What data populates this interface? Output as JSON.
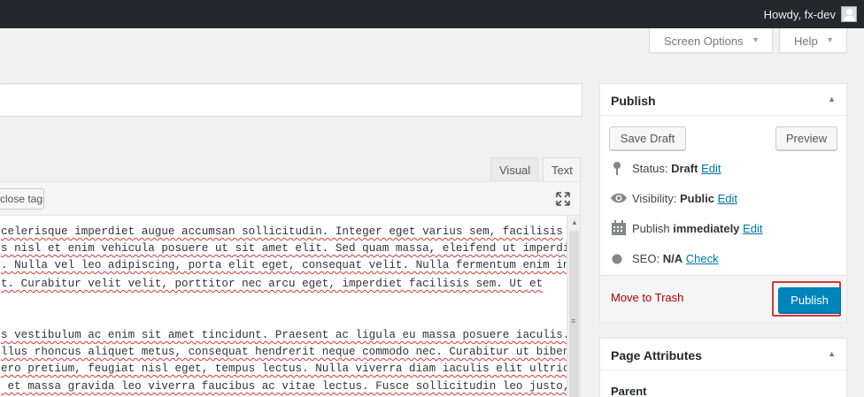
{
  "admin_bar": {
    "greeting": "Howdy, fx-dev"
  },
  "screen_meta": {
    "screen_options": "Screen Options",
    "help": "Help",
    "arrow": "▼"
  },
  "editor": {
    "tabs": {
      "visual": "Visual",
      "text": "Text"
    },
    "toolbar": {
      "close_tags": "close tags"
    },
    "content_lines": [
      "celerisque imperdiet augue accumsan sollicitudin. Integer eget varius sem, facilisis",
      "s nisl et enim vehicula posuere ut sit amet elit. Sed quam massa, eleifend ut imperdiet",
      ". Nulla vel leo adipiscing, porta elit eget, consequat velit. Nulla fermentum enim in",
      "t. Curabitur velit velit, porttitor nec arcu eget, imperdiet facilisis sem. Ut et",
      "",
      "s vestibulum ac enim sit amet tincidunt. Praesent ac ligula eu massa posuere iaculis.",
      "llus rhoncus aliquet metus, consequat hendrerit neque commodo nec. Curabitur ut bibendum",
      "ero pretium, feugiat nisl eget, tempus lectus. Nulla viverra diam iaculis elit ultricies",
      " et massa gravida leo viverra faucibus ac vitae lectus. Fusce sollicitudin leo justo,"
    ]
  },
  "publish_box": {
    "title": "Publish",
    "toggle": "▲",
    "save_draft": "Save Draft",
    "preview": "Preview",
    "status": {
      "label": "Status:",
      "value": "Draft",
      "link": "Edit",
      "icon": "pin-icon"
    },
    "visibility": {
      "label": "Visibility:",
      "value": "Public",
      "link": "Edit",
      "icon": "eye-icon"
    },
    "schedule": {
      "label": "Publish",
      "value": "immediately",
      "link": "Edit",
      "icon": "calendar-icon"
    },
    "seo": {
      "label": "SEO:",
      "value": "N/A",
      "link": "Check",
      "icon": "circle-icon"
    },
    "move_to_trash": "Move to Trash",
    "publish_button": "Publish",
    "colors": {
      "publish_button": "#0085ba",
      "highlight": "#d63638",
      "trash": "#a00",
      "link": "#0073aa"
    }
  },
  "page_attributes_box": {
    "title": "Page Attributes",
    "toggle": "▲",
    "parent_label": "Parent"
  }
}
